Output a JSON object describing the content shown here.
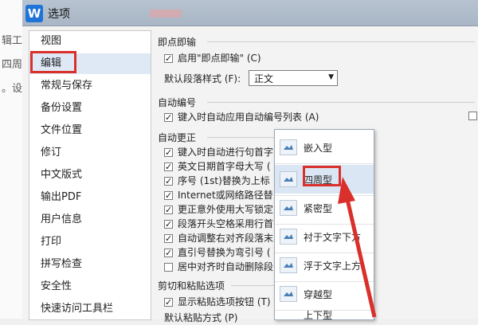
{
  "background_doc": {
    "line1": "辑工",
    "line2": "四周",
    "line3": "。设"
  },
  "dialog": {
    "title": "选项",
    "app_icon_text": "W"
  },
  "sidebar": {
    "items": [
      {
        "label": "视图"
      },
      {
        "label": "编辑"
      },
      {
        "label": "常规与保存"
      },
      {
        "label": "备份设置"
      },
      {
        "label": "文件位置"
      },
      {
        "label": "修订"
      },
      {
        "label": "中文版式"
      },
      {
        "label": "输出PDF"
      },
      {
        "label": "用户信息"
      },
      {
        "label": "打印"
      },
      {
        "label": "拼写检查"
      },
      {
        "label": "安全性"
      },
      {
        "label": "快速访问工具栏"
      }
    ],
    "selected_index": 1
  },
  "sections": {
    "instant_input": {
      "title": "即点即输",
      "enable_label": "启用\"即点即输\" (C)",
      "enable_checked": true,
      "default_style_label": "默认段落样式 (F):",
      "default_style_value": "正文"
    },
    "auto_number": {
      "title": "自动编号",
      "apply_label": "键入时自动应用自动编号列表 (A)",
      "apply_checked": true
    },
    "auto_correct": {
      "title": "自动更正",
      "items": [
        {
          "label": "键入时自动进行句首字",
          "checked": true
        },
        {
          "label": "英文日期首字母大写 (",
          "checked": true
        },
        {
          "label": "序号 (1st)替换为上标",
          "checked": true
        },
        {
          "label": "Internet或网络路径替",
          "checked": true
        },
        {
          "label": "更正意外使用大写锁定",
          "checked": true
        },
        {
          "label": "段落开头空格采用行首",
          "checked": true
        },
        {
          "label": "自动调整右对齐段落末",
          "checked": true
        },
        {
          "label": "直引号替换为弯引号 (",
          "checked": true
        },
        {
          "label": "居中对齐时自动删除段",
          "checked": false
        }
      ]
    },
    "paste": {
      "title": "剪切和粘贴选项",
      "show_button_label": "显示粘贴选项按钮 (T)",
      "show_button_checked": true,
      "cut_label": "默认粘贴方式 (P)"
    }
  },
  "wrap_menu": {
    "items": [
      {
        "label": "嵌入型",
        "icon": "inline-wrap-icon"
      },
      {
        "label": "四周型",
        "icon": "square-wrap-icon"
      },
      {
        "label": "紧密型",
        "icon": "tight-wrap-icon"
      },
      {
        "label": "衬于文字下方",
        "icon": "behind-text-icon"
      },
      {
        "label": "浮于文字上方",
        "icon": "front-text-icon"
      },
      {
        "label": "穿越型",
        "icon": "through-wrap-icon"
      },
      {
        "label": "上下型",
        "icon": "top-bottom-wrap-icon"
      }
    ],
    "highlighted_index": 1
  },
  "colors": {
    "annotation_red": "#d9302c",
    "selection_blue": "#dfe9f6",
    "brand_blue": "#1e73d8"
  }
}
